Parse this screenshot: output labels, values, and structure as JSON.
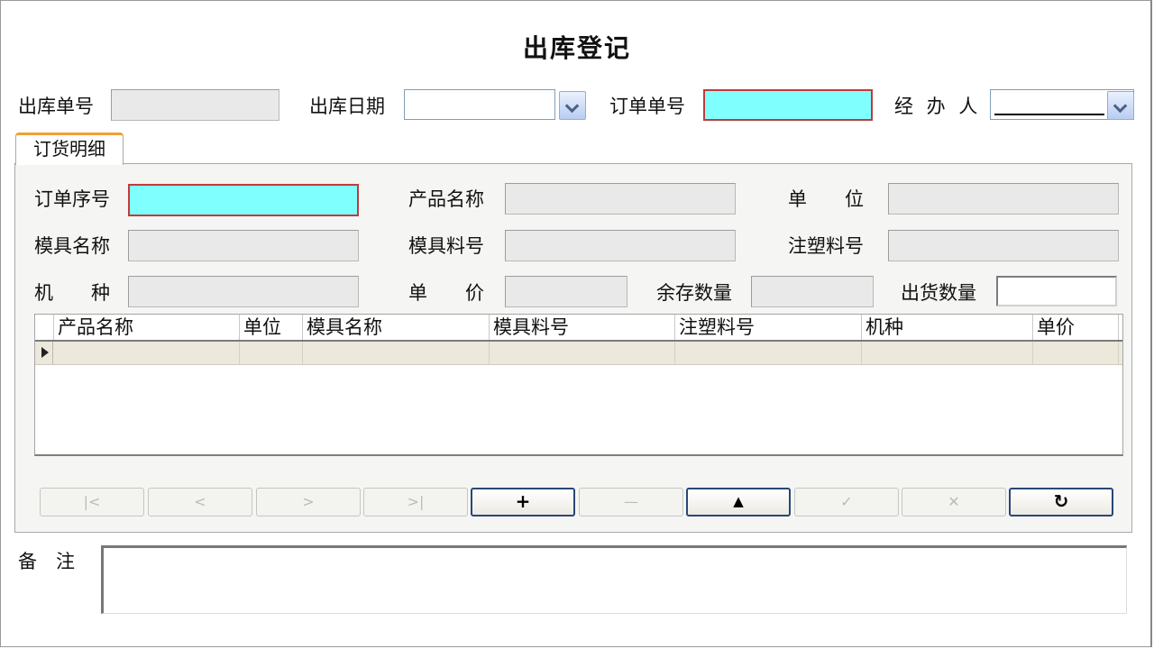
{
  "title": "出库登记",
  "header": {
    "out_no_label": "出库单号",
    "out_date_label": "出库日期",
    "order_no_label": "订单单号",
    "handler_label": "经 办 人"
  },
  "tab": {
    "label": "订货明细"
  },
  "detail": {
    "order_seq_label": "订单序号",
    "product_name_label": "产品名称",
    "unit_label": "单　　位",
    "mold_name_label": "模具名称",
    "mold_part_label": "模具料号",
    "inject_part_label": "注塑料号",
    "machine_label": "机　　种",
    "price_label": "单　　价",
    "stock_qty_label": "余存数量",
    "ship_qty_label": "出货数量"
  },
  "grid": {
    "columns": [
      "产品名称",
      "单位",
      "模具名称",
      "模具料号",
      "注塑料号",
      "机种",
      "单价"
    ]
  },
  "nav": {
    "first": "|<",
    "prev": "<",
    "next": ">",
    "last": ">|",
    "add": "+",
    "delete": "—",
    "edit": "▲",
    "post": "✓",
    "cancel": "✕",
    "refresh": "↻"
  },
  "notes": {
    "label": "备　注"
  },
  "colors": {
    "required": "#80ffff",
    "required_border": "#c23a3a",
    "tab_accent": "#f0a030"
  }
}
